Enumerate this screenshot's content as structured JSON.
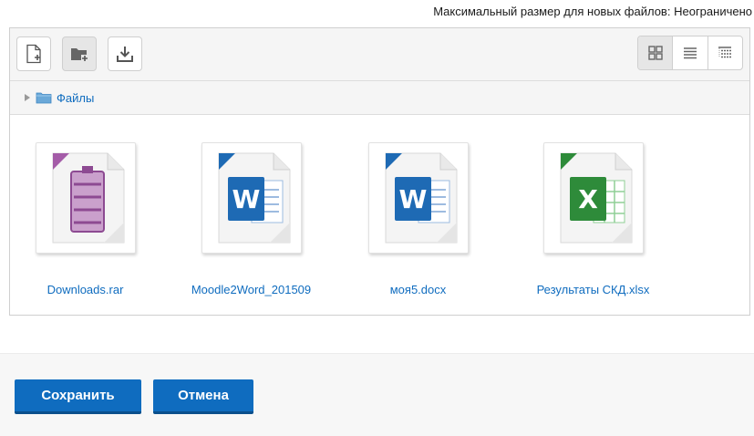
{
  "maxsize": {
    "label": "Максимальный размер для новых файлов:",
    "value": "Неограничено"
  },
  "toolbar": {
    "buttons": [
      {
        "icon": "add-file-icon"
      },
      {
        "icon": "create-folder-icon"
      },
      {
        "icon": "download-icon"
      }
    ],
    "views": [
      {
        "icon": "grid-view-icon",
        "active": true
      },
      {
        "icon": "list-view-icon",
        "active": false
      },
      {
        "icon": "tree-view-icon",
        "active": false
      }
    ]
  },
  "path": {
    "folder": "Файлы"
  },
  "files": [
    {
      "name": "Downloads.rar",
      "type": "archive",
      "ribbon": "#a45ca8"
    },
    {
      "name": "Moodle2Word_201509",
      "type": "word",
      "ribbon": "#1e6ab4"
    },
    {
      "name": "моя5.docx",
      "type": "word",
      "ribbon": "#1e6ab4"
    },
    {
      "name": "Результаты СКД.xlsx",
      "type": "excel",
      "ribbon": "#2e8b3a"
    }
  ],
  "buttons": {
    "save": "Сохранить",
    "cancel": "Отмена"
  },
  "colors": {
    "accent": "#0f6cbf",
    "word": "#1e6ab4",
    "excel": "#2e8b3a",
    "archive": "#a45ca8"
  }
}
